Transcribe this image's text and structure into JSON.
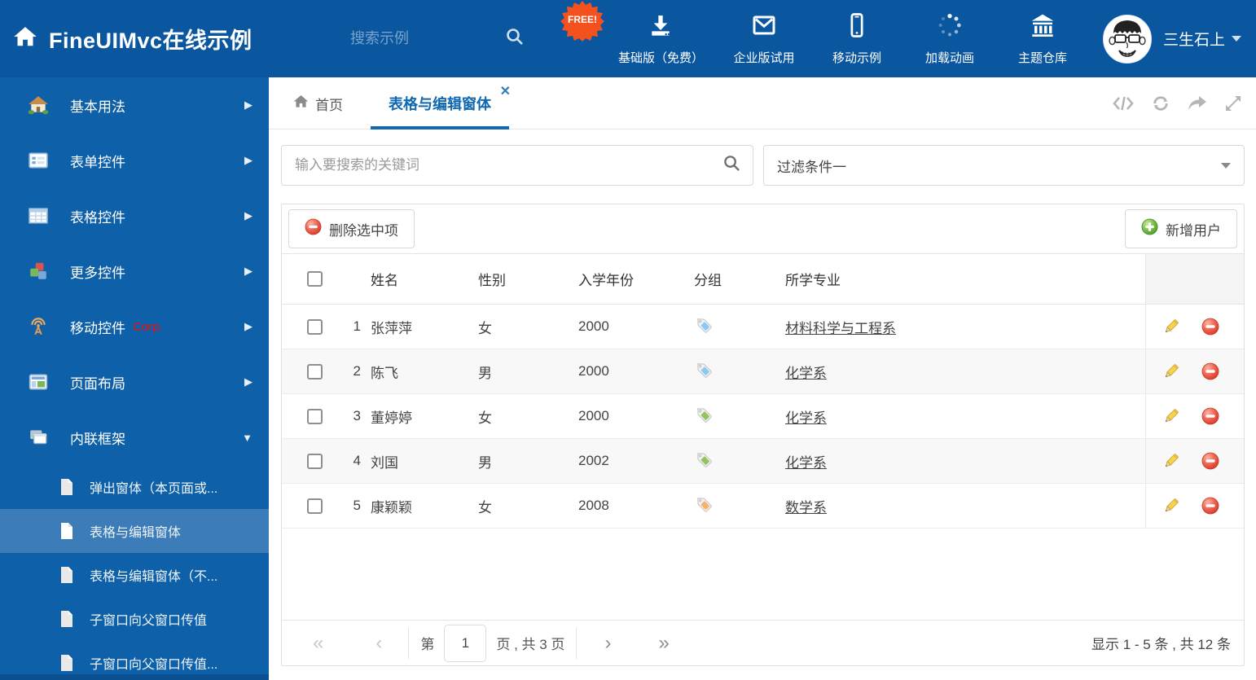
{
  "theme": {
    "header_bg": "#0a57a0",
    "sidebar_bg": "#0e61a8",
    "sidebar_selected_bg": "#3c7cb8",
    "accent_blue": "#0f68b0",
    "free_badge_bg": "#f4511e",
    "delete_red": "#e2574c",
    "add_green": "#5aa430",
    "pencil_yellow": "#f3d44a"
  },
  "header": {
    "brand": "FineUIMvc在线示例",
    "search_placeholder": "搜索示例",
    "free_badge": "FREE!",
    "nav_items": [
      {
        "label": "基础版（免费）",
        "icon": "download-icon"
      },
      {
        "label": "企业版试用",
        "icon": "envelope-icon"
      },
      {
        "label": "移动示例",
        "icon": "mobile-icon"
      },
      {
        "label": "加载动画",
        "icon": "spinner-icon"
      },
      {
        "label": "主题仓库",
        "icon": "bank-icon"
      }
    ],
    "user_name": "三生石上"
  },
  "sidebar": {
    "items": [
      {
        "label": "基本用法"
      },
      {
        "label": "表单控件"
      },
      {
        "label": "表格控件"
      },
      {
        "label": "更多控件"
      },
      {
        "label": "移动控件",
        "badge": "Corp."
      },
      {
        "label": "页面布局"
      },
      {
        "label": "内联框架",
        "expanded": true
      }
    ],
    "subitems": [
      {
        "label": "弹出窗体（本页面或..."
      },
      {
        "label": "表格与编辑窗体",
        "selected": true
      },
      {
        "label": "表格与编辑窗体（不..."
      },
      {
        "label": "子窗口向父窗口传值"
      },
      {
        "label": "子窗口向父窗口传值..."
      }
    ]
  },
  "tabs": [
    {
      "label": "首页"
    },
    {
      "label": "表格与编辑窗体",
      "active": true,
      "closable": true
    }
  ],
  "content": {
    "search_placeholder": "输入要搜索的关键词",
    "filter_value": "过滤条件一",
    "delete_button": "删除选中项",
    "add_button": "新增用户"
  },
  "grid": {
    "columns": [
      "姓名",
      "性别",
      "入学年份",
      "分组",
      "所学专业"
    ],
    "rows": [
      {
        "num": "1",
        "name": "张萍萍",
        "gender": "女",
        "year": "2000",
        "tag_color": "#8ec9f2",
        "major": "材料科学与工程系"
      },
      {
        "num": "2",
        "name": "陈飞",
        "gender": "男",
        "year": "2000",
        "tag_color": "#8ec9f2",
        "major": "化学系"
      },
      {
        "num": "3",
        "name": "董婷婷",
        "gender": "女",
        "year": "2000",
        "tag_color": "#94c35f",
        "major": "化学系"
      },
      {
        "num": "4",
        "name": "刘国",
        "gender": "男",
        "year": "2002",
        "tag_color": "#94c35f",
        "major": "化学系"
      },
      {
        "num": "5",
        "name": "康颖颖",
        "gender": "女",
        "year": "2008",
        "tag_color": "#f6b26d",
        "major": "数学系"
      }
    ]
  },
  "pager": {
    "prefix": "第",
    "page_value": "1",
    "suffix": "页 , 共 3 页",
    "info": "显示 1 - 5 条 , 共 12 条"
  }
}
